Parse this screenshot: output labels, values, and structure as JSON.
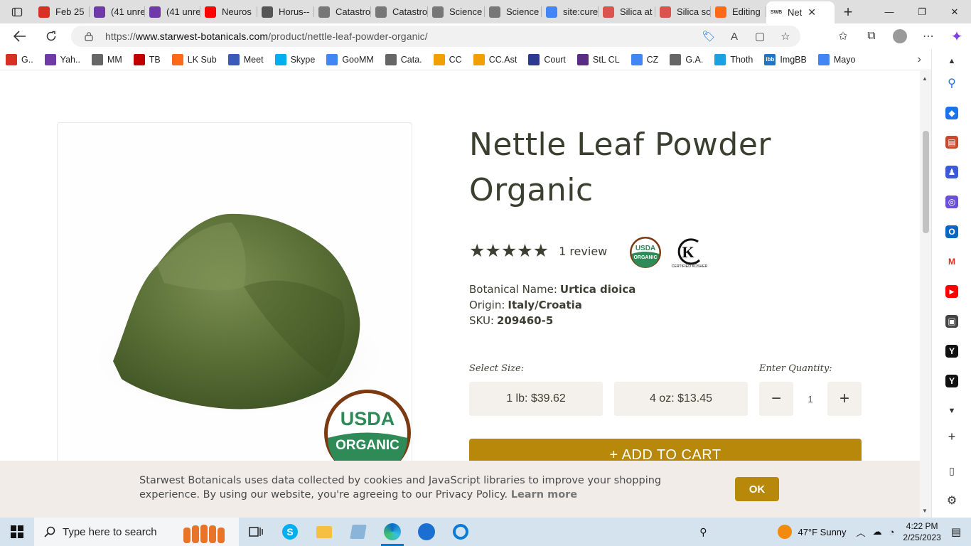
{
  "browser": {
    "tabs": [
      {
        "label": "Feb 25",
        "icon": "gmail-icon",
        "color": "#d93025"
      },
      {
        "label": "(41 unre",
        "icon": "yahoo-mail-icon",
        "color": "#6f3aa8"
      },
      {
        "label": "(41 unre",
        "icon": "yahoo-mail-icon",
        "color": "#6f3aa8"
      },
      {
        "label": "Neuros",
        "icon": "youtube-icon",
        "color": "#ff0000"
      },
      {
        "label": "Horus--",
        "icon": "page-icon",
        "color": "#555555"
      },
      {
        "label": "Catastro",
        "icon": "document-icon",
        "color": "#777777"
      },
      {
        "label": "Catastro",
        "icon": "document-icon",
        "color": "#777777"
      },
      {
        "label": "Science",
        "icon": "document-icon",
        "color": "#777777"
      },
      {
        "label": "Science",
        "icon": "document-icon",
        "color": "#777777"
      },
      {
        "label": "site:cure",
        "icon": "google-icon",
        "color": "#4285f4"
      },
      {
        "label": "Silica at",
        "icon": "apple-icon",
        "color": "#d9534f"
      },
      {
        "label": "Silica sc",
        "icon": "apple-icon",
        "color": "#d9534f"
      },
      {
        "label": "Editing",
        "icon": "substack-icon",
        "color": "#ff6719"
      },
      {
        "label": "Net",
        "icon": "swb-icon",
        "color": "#ffffff",
        "fav_text": "SWB"
      }
    ],
    "url_prefix": "https://",
    "url_host": "www.starwest-botanicals.com",
    "url_path": "/product/nettle-leaf-powder-organic/",
    "bookmarks": [
      {
        "label": "G..",
        "icon": "gmail-icon",
        "color": "#d93025"
      },
      {
        "label": "Yah..",
        "icon": "yahoo-mail-icon",
        "color": "#6f3aa8"
      },
      {
        "label": "MM",
        "icon": "document-icon",
        "color": "#666666"
      },
      {
        "label": "TB",
        "icon": "tb-icon",
        "color": "#c00000"
      },
      {
        "label": "LK Sub",
        "icon": "substack-icon",
        "color": "#ff6719"
      },
      {
        "label": "Meet",
        "icon": "meet-icon",
        "color": "#3b5ab8"
      },
      {
        "label": "Skype",
        "icon": "skype-icon",
        "color": "#00aff0"
      },
      {
        "label": "GooMM",
        "icon": "google-icon",
        "color": "#4285f4"
      },
      {
        "label": "Cata.",
        "icon": "document-icon",
        "color": "#666666"
      },
      {
        "label": "CC",
        "icon": "arrow-bookmark-icon",
        "color": "#f0a000"
      },
      {
        "label": "CC.Ast",
        "icon": "arrow-bookmark-icon",
        "color": "#f0a000"
      },
      {
        "label": "Court",
        "icon": "court-icon",
        "color": "#2b3990"
      },
      {
        "label": "StL CL",
        "icon": "peace-icon",
        "color": "#5b2c83"
      },
      {
        "label": "CZ",
        "icon": "google-icon",
        "color": "#4285f4"
      },
      {
        "label": "G.A.",
        "icon": "document-icon",
        "color": "#666666"
      },
      {
        "label": "Thoth",
        "icon": "thoth-icon",
        "color": "#1ba1e2"
      },
      {
        "label": "ImgBB",
        "icon": "imgbb-icon",
        "color": "#1f76c6",
        "fav_text": "ibb"
      },
      {
        "label": "Mayo",
        "icon": "google-icon",
        "color": "#4285f4"
      }
    ]
  },
  "product": {
    "title_line1": "Nettle Leaf Powder",
    "title_line2": "Organic",
    "rating_stars": 5,
    "stars_text": "★★★★★",
    "reviews": "1 review",
    "usda_top": "USDA",
    "usda_bottom": "ORGANIC",
    "kosher_text": "CERTIFIED KOSHER",
    "botanical_label": "Botanical Name:",
    "botanical_value": "Urtica dioica",
    "origin_label": "Origin:",
    "origin_value": "Italy/Croatia",
    "sku_label": "SKU:",
    "sku_value": "209460-5",
    "select_size_label": "Select Size:",
    "sizes": [
      "1 lb: $39.62",
      "4 oz: $13.45"
    ],
    "quantity_label": "Enter Quantity:",
    "quantity": "1",
    "minus": "−",
    "plus": "+",
    "add_to_cart": "+ ADD TO CART"
  },
  "cookie_banner": {
    "text": "Starwest Botanicals uses data collected by cookies and JavaScript libraries to improve your shopping experience. By using our website, you're agreeing to our Privacy Policy.",
    "learn_more": "Learn more",
    "ok": "OK"
  },
  "taskbar": {
    "search_placeholder": "Type here to search",
    "weather": "47°F  Sunny",
    "time": "4:22 PM",
    "date": "2/25/2023"
  },
  "colors": {
    "accent_gold": "#b8880a",
    "title_text": "#3a3f2f",
    "usda_green": "#2e8b57",
    "usda_brown": "#7b3a12"
  }
}
